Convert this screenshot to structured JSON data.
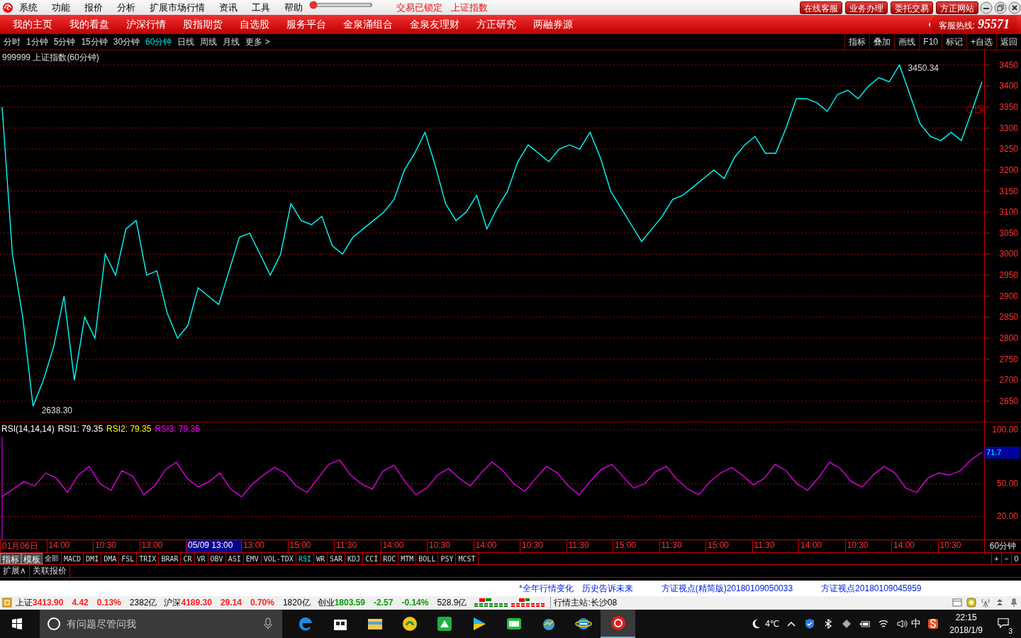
{
  "menu_bar": {
    "items": [
      "系统",
      "功能",
      "报价",
      "分析",
      "扩展市场行情",
      "资讯",
      "工具",
      "帮助"
    ],
    "status": [
      "交易已锁定",
      "上证指数"
    ],
    "buttons": [
      "在线客服",
      "业务办理",
      "委托交易",
      "方正网站"
    ]
  },
  "nav": {
    "items": [
      "我的主页",
      "我的看盘",
      "沪深行情",
      "股指期货",
      "自选股",
      "服务平台",
      "金泉涌组合",
      "金泉友理财",
      "方正研究",
      "两融券源"
    ],
    "hotline_label": "客服热线:",
    "hotline": "95571"
  },
  "periods": [
    {
      "label": "分时",
      "selected": false
    },
    {
      "label": "1分钟",
      "selected": false
    },
    {
      "label": "5分钟",
      "selected": false
    },
    {
      "label": "15分钟",
      "selected": false
    },
    {
      "label": "30分钟",
      "selected": false
    },
    {
      "label": "60分钟",
      "selected": true
    },
    {
      "label": "日线",
      "selected": false
    },
    {
      "label": "周线",
      "selected": false
    },
    {
      "label": "月线",
      "selected": false
    },
    {
      "label": "更多 >",
      "selected": false
    }
  ],
  "tools": [
    "指标",
    "叠加",
    "画线",
    "F10",
    "标记",
    "+自选",
    "返回"
  ],
  "price_chart": {
    "title": "999999 上证指数(60分钟)",
    "chart_data": {
      "type": "line",
      "values": [
        3350,
        3000,
        2850,
        2638,
        2700,
        2780,
        2900,
        2700,
        2850,
        2800,
        3000,
        2950,
        3060,
        3080,
        2950,
        2960,
        2860,
        2800,
        2830,
        2920,
        2900,
        2880,
        2960,
        3040,
        3050,
        3000,
        2950,
        3000,
        3120,
        3080,
        3070,
        3090,
        3020,
        3000,
        3040,
        3060,
        3080,
        3100,
        3130,
        3200,
        3240,
        3290,
        3210,
        3120,
        3080,
        3100,
        3140,
        3060,
        3110,
        3150,
        3220,
        3260,
        3240,
        3220,
        3250,
        3260,
        3250,
        3290,
        3230,
        3150,
        3110,
        3070,
        3030,
        3060,
        3090,
        3130,
        3140,
        3160,
        3180,
        3200,
        3180,
        3230,
        3260,
        3280,
        3240,
        3240,
        3300,
        3370,
        3370,
        3360,
        3340,
        3380,
        3390,
        3370,
        3400,
        3420,
        3410,
        3450,
        3380,
        3310,
        3280,
        3270,
        3290,
        3270,
        3340,
        3410
      ],
      "ylim": [
        2601,
        3485
      ],
      "yticks": [
        2650,
        2700,
        2750,
        2800,
        2850,
        2900,
        2950,
        3000,
        3050,
        3100,
        3150,
        3200,
        3250,
        3300,
        3350,
        3400,
        3450
      ],
      "grid": true,
      "annotations": [
        "3450.34",
        "2638.30"
      ]
    }
  },
  "indicator_chart": {
    "legend": [
      {
        "text": "RSI(14,14,14)",
        "color": "#ffffff"
      },
      {
        "text": "RSI1: 79.35",
        "color": "#ffffff"
      },
      {
        "text": "RSI2: 79.35",
        "color": "#ffff00"
      },
      {
        "text": "RSI3: 79.35",
        "color": "#ff00ff"
      }
    ],
    "current": "71.7",
    "chart_data": {
      "type": "line",
      "values": [
        38,
        45,
        52,
        48,
        60,
        55,
        42,
        58,
        66,
        50,
        44,
        62,
        57,
        40,
        48,
        63,
        70,
        55,
        47,
        52,
        60,
        45,
        38,
        50,
        58,
        65,
        60,
        48,
        42,
        55,
        68,
        72,
        58,
        50,
        45,
        62,
        67,
        52,
        40,
        46,
        58,
        64,
        55,
        48,
        60,
        70,
        62,
        50,
        43,
        55,
        66,
        60,
        48,
        40,
        52,
        63,
        68,
        57,
        46,
        50,
        61,
        66,
        54,
        45,
        40,
        52,
        60,
        65,
        58,
        49,
        55,
        68,
        62,
        50,
        44,
        56,
        70,
        64,
        52,
        47,
        58,
        66,
        60,
        46,
        42,
        55,
        60,
        58,
        62,
        72,
        79
      ],
      "grid": true,
      "ylim": [
        -1.3,
        106.5
      ],
      "yticks": [
        {
          "value": 100,
          "label": "100.00"
        },
        {
          "value": 50,
          "label": "50.00"
        },
        {
          "value": 20,
          "label": "20.00"
        }
      ]
    }
  },
  "time_axis": {
    "labels": [
      {
        "text": "01月06日",
        "selected": false
      },
      {
        "text": "14:00",
        "selected": false
      },
      {
        "text": "10:30",
        "selected": false
      },
      {
        "text": "13:00",
        "selected": false
      },
      {
        "text": "05/09 13:00",
        "selected": true
      },
      {
        "text": "13:00",
        "selected": false
      },
      {
        "text": "15:00",
        "selected": false
      },
      {
        "text": "11:30",
        "selected": false
      },
      {
        "text": "14:00",
        "selected": false
      },
      {
        "text": "10:30",
        "selected": false
      },
      {
        "text": "14:00",
        "selected": false
      },
      {
        "text": "10:30",
        "selected": false
      },
      {
        "text": "11:30",
        "selected": false
      },
      {
        "text": "15:00",
        "selected": false
      },
      {
        "text": "11:30",
        "selected": false
      },
      {
        "text": "15:00",
        "selected": false
      },
      {
        "text": "11:30",
        "selected": false
      },
      {
        "text": "14:00",
        "selected": false
      },
      {
        "text": "10:30",
        "selected": false
      },
      {
        "text": "14:00",
        "selected": false
      },
      {
        "text": "10:30",
        "selected": false
      }
    ],
    "period": "60分钟"
  },
  "indicator_bar": {
    "modes": [
      "指标",
      "模板"
    ],
    "indicators": [
      {
        "label": "全部",
        "selected": false
      },
      {
        "label": "MACD",
        "selected": false
      },
      {
        "label": "DMI",
        "selected": false
      },
      {
        "label": "DMA",
        "selected": false
      },
      {
        "label": "FSL",
        "selected": false
      },
      {
        "label": "TRIX",
        "selected": false
      },
      {
        "label": "BRAR",
        "selected": false
      },
      {
        "label": "CR",
        "selected": false
      },
      {
        "label": "VR",
        "selected": false
      },
      {
        "label": "OBV",
        "selected": false
      },
      {
        "label": "ASI",
        "selected": false
      },
      {
        "label": "EMV",
        "selected": false
      },
      {
        "label": "VOL-TDX",
        "selected": false
      },
      {
        "label": "RSI",
        "selected": true
      },
      {
        "label": "WR",
        "selected": false
      },
      {
        "label": "SAR",
        "selected": false
      },
      {
        "label": "KDJ",
        "selected": false
      },
      {
        "label": "CCI",
        "selected": false
      },
      {
        "label": "ROC",
        "selected": false
      },
      {
        "label": "MTM",
        "selected": false
      },
      {
        "label": "BOLL",
        "selected": false
      },
      {
        "label": "PSY",
        "selected": false
      },
      {
        "label": "MCST",
        "selected": false
      }
    ],
    "zoom_buttons": [
      "+",
      "−",
      "0"
    ]
  },
  "extension_bar": [
    "扩展∧",
    "关联报价"
  ],
  "news": [
    "*全年行情变化",
    "历史告诉未来",
    "方证视点(精简版)20180109050033",
    "方证视点20180109045959"
  ],
  "status_bar": {
    "indices": [
      {
        "name": "上证",
        "value": "3413.90",
        "change": "4.42",
        "pct": "0.13%",
        "volume": "2382亿",
        "color": "#ff2020"
      },
      {
        "name": "沪深",
        "value": "4189.30",
        "change": "29.14",
        "pct": "0.70%",
        "volume": "1820亿",
        "color": "#ff2020"
      },
      {
        "name": "创业",
        "value": "1803.59",
        "change": "-2.57",
        "pct": "-0.14%",
        "volume": "528.9亿",
        "color": "#00a000"
      }
    ],
    "server": "行情主站:长沙08"
  },
  "taskbar": {
    "search_placeholder": "有问题尽管问我",
    "apps": [
      {
        "kind": "edge",
        "selected": false
      },
      {
        "kind": "store",
        "selected": false
      },
      {
        "kind": "folder",
        "selected": false
      },
      {
        "kind": "music",
        "selected": false
      },
      {
        "kind": "green",
        "selected": false
      },
      {
        "kind": "video",
        "selected": false
      },
      {
        "kind": "tv",
        "selected": false
      },
      {
        "kind": "stock",
        "selected": false
      },
      {
        "kind": "ie",
        "selected": false
      },
      {
        "kind": "swirl",
        "selected": true
      }
    ],
    "weather": "4℃",
    "ime": "中",
    "time": "22:15",
    "date": "2018/1/9",
    "notifications": "3"
  }
}
